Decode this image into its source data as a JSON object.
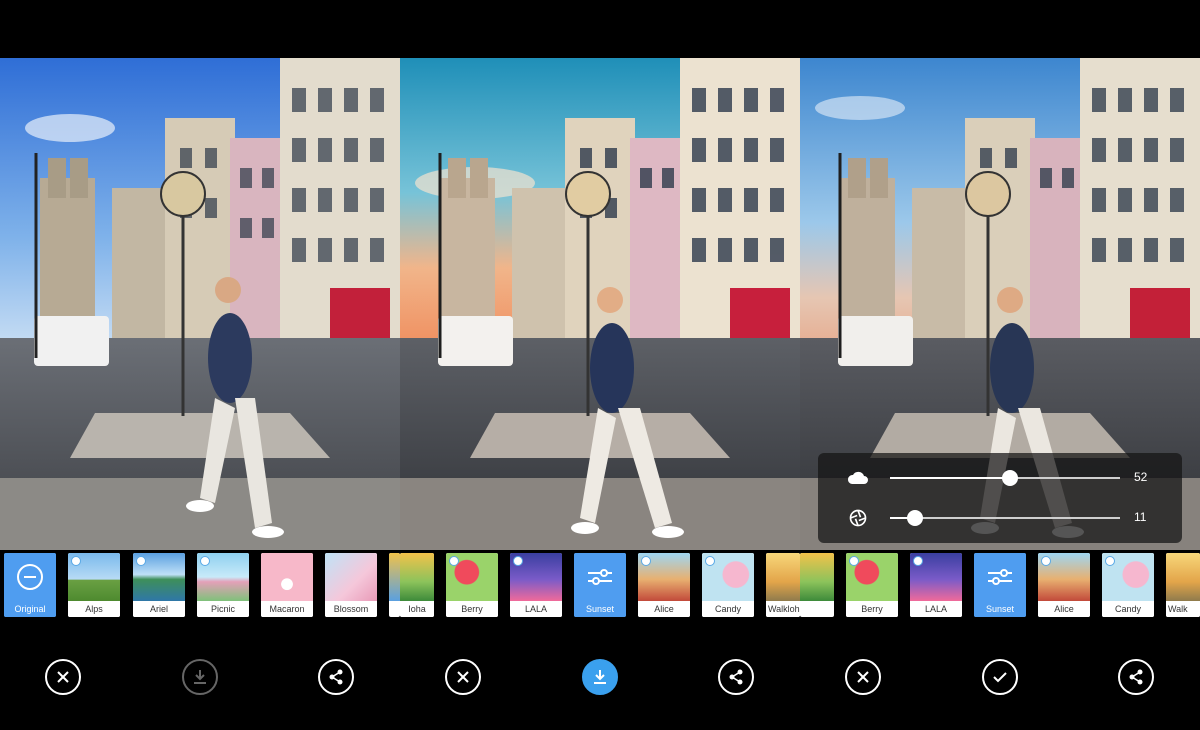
{
  "panels": [
    {
      "filters": [
        {
          "label": "Original",
          "selected": true
        },
        {
          "label": "Alps"
        },
        {
          "label": "Ariel"
        },
        {
          "label": "Picnic"
        },
        {
          "label": "Macaron"
        },
        {
          "label": "Blossom"
        }
      ],
      "buttons": {
        "close": "close-icon",
        "download": "download-icon",
        "share": "share-icon"
      }
    },
    {
      "filters": [
        {
          "label": "Ioha"
        },
        {
          "label": "Berry"
        },
        {
          "label": "LALA"
        },
        {
          "label": "Sunset",
          "selected": true
        },
        {
          "label": "Alice"
        },
        {
          "label": "Candy"
        },
        {
          "label": "Walkloha"
        }
      ],
      "buttons": {
        "close": "close-icon",
        "download": "download-icon",
        "share": "share-icon"
      }
    },
    {
      "filters": [
        {
          "label": "Ioha"
        },
        {
          "label": "Berry"
        },
        {
          "label": "LALA"
        },
        {
          "label": "Sunset",
          "selected": true
        },
        {
          "label": "Alice"
        },
        {
          "label": "Candy"
        },
        {
          "label": "Walk"
        }
      ],
      "adjust": [
        {
          "icon": "cloud-icon",
          "value": "52",
          "level": 0.52
        },
        {
          "icon": "aperture-icon",
          "value": "11",
          "level": 0.11
        }
      ],
      "buttons": {
        "close": "close-icon",
        "confirm": "check-icon",
        "share": "share-icon"
      }
    }
  ],
  "colors": {
    "accent": "#3aa0ee",
    "selected_filter": "#4f9df0"
  }
}
